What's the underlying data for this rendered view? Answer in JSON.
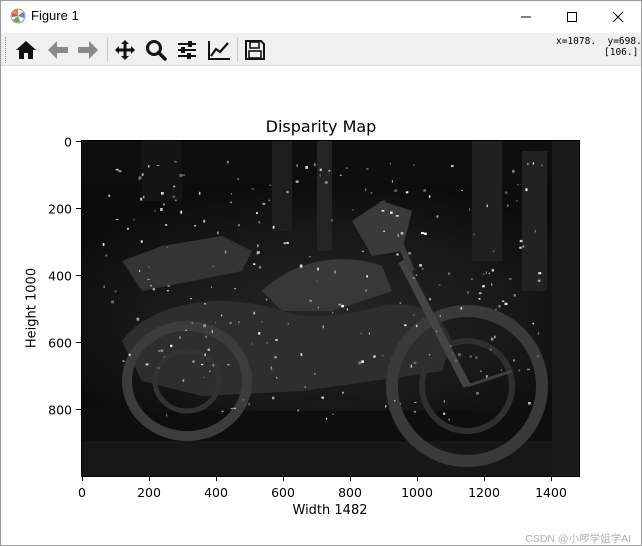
{
  "window": {
    "title": "Figure 1",
    "minimize_icon": "minimize-icon",
    "maximize_icon": "maximize-icon",
    "close_icon": "close-icon"
  },
  "toolbar": {
    "buttons": [
      {
        "name": "home",
        "icon": "home-icon"
      },
      {
        "name": "back",
        "icon": "arrow-left-icon"
      },
      {
        "name": "forward",
        "icon": "arrow-right-icon"
      },
      {
        "name": "pan",
        "icon": "move-icon"
      },
      {
        "name": "zoom",
        "icon": "zoom-icon"
      },
      {
        "name": "subplots",
        "icon": "sliders-icon"
      },
      {
        "name": "edit-axes",
        "icon": "line-chart-icon"
      },
      {
        "name": "save",
        "icon": "save-icon"
      }
    ],
    "cursor_readout_line1": "x=1078.  y=698.",
    "cursor_readout_line2": "[106.]"
  },
  "chart_data": {
    "type": "heatmap",
    "title": "Disparity Map",
    "xlabel": "Width 1482",
    "ylabel": "Height 1000",
    "xlim": [
      0,
      1482
    ],
    "ylim": [
      1000,
      0
    ],
    "xticks": [
      0,
      200,
      400,
      600,
      800,
      1000,
      1200,
      1400
    ],
    "yticks": [
      0,
      200,
      400,
      600,
      800
    ],
    "colormap": "gray",
    "image_content": "grayscale disparity image of a motorcycle"
  },
  "watermark": "CSDN @小啰学姐学AI"
}
